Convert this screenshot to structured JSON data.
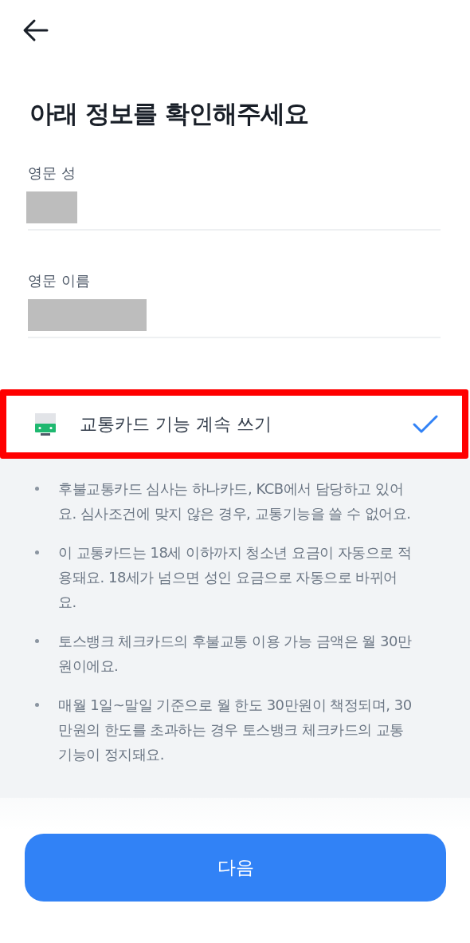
{
  "title": "아래 정보를 확인해주세요",
  "fields": [
    {
      "label": "영문 성",
      "redacted": true
    },
    {
      "label": "영문 이름",
      "redacted": true
    }
  ],
  "option": {
    "label": "교통카드 기능 계속 쓰기",
    "checked": true,
    "highlighted": true
  },
  "notes": [
    "후불교통카드 심사는 하나카드, KCB에서 담당하고 있어요. 심사조건에 맞지 않은 경우, 교통기능을 쓸 수 없어요.",
    "이 교통카드는 18세 이하까지 청소년 요금이 자동으로 적용돼요. 18세가 넘으면 성인 요금으로 자동으로 바뀌어요.",
    "토스뱅크 체크카드의 후불교통 이용 가능 금액은 월 30만원이에요.",
    "매월 1일~말일 기준으로 월 한도 30만원이 책정되며, 30만원의 한도를 초과하는 경우 토스뱅크 체크카드의 교통 기능이 정지돼요."
  ],
  "button": "다음"
}
